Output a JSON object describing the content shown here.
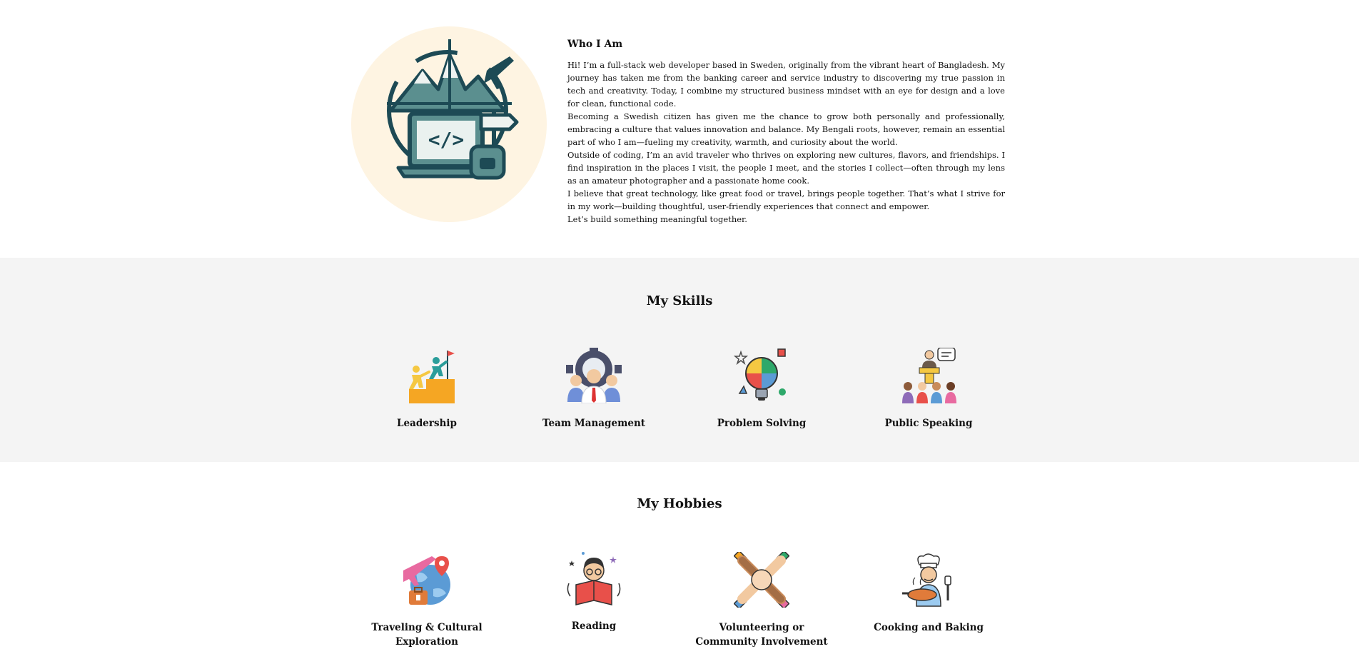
{
  "about": {
    "title": "Who I Am",
    "paragraphs": [
      "Hi! I’m a full-stack web developer based in Sweden, originally from the vibrant heart of Bangladesh. My journey has taken me from the banking career and service industry to discovering my true passion in tech and creativity. Today, I combine my structured business mindset with an eye for design and a love for clean, functional code.",
      "Becoming a Swedish citizen has given me the chance to grow both personally and professionally, embracing a culture that values innovation and balance. My Bengali roots, however, remain an essential part of who I am—fueling my creativity, warmth, and curiosity about the world.",
      "Outside of coding, I’m an avid traveler who thrives on exploring new cultures, flavors, and friendships. I find inspiration in the places I visit, the people I meet, and the stories I collect—often through my lens as an amateur photographer and a passionate home cook.",
      "I believe that great technology, like great food or travel, brings people together. That’s what I strive for in my work—building thoughtful, user-friendly experiences that connect and empower.",
      "Let’s build something meaningful together."
    ],
    "avatar_icon": "developer-traveler-icon"
  },
  "skills": {
    "title": "My Skills",
    "items": [
      {
        "label": "Leadership",
        "icon": "leadership-icon"
      },
      {
        "label": "Team Management",
        "icon": "team-management-icon"
      },
      {
        "label": "Problem Solving",
        "icon": "problem-solving-icon"
      },
      {
        "label": "Public Speaking",
        "icon": "public-speaking-icon"
      }
    ]
  },
  "hobbies": {
    "title": "My Hobbies",
    "items": [
      {
        "label": "Traveling & Cultural Exploration",
        "icon": "travel-icon"
      },
      {
        "label": "Reading",
        "icon": "reading-icon"
      },
      {
        "label": "Volunteering or Community Involvement",
        "icon": "volunteering-icon"
      },
      {
        "label": "Cooking and Baking",
        "icon": "cooking-icon"
      }
    ]
  },
  "colors": {
    "avatar_bg": "#fef4e2",
    "skills_bg": "#f4f4f4",
    "icon_dark": "#1d4a55",
    "icon_teal": "#5b8f8f"
  }
}
